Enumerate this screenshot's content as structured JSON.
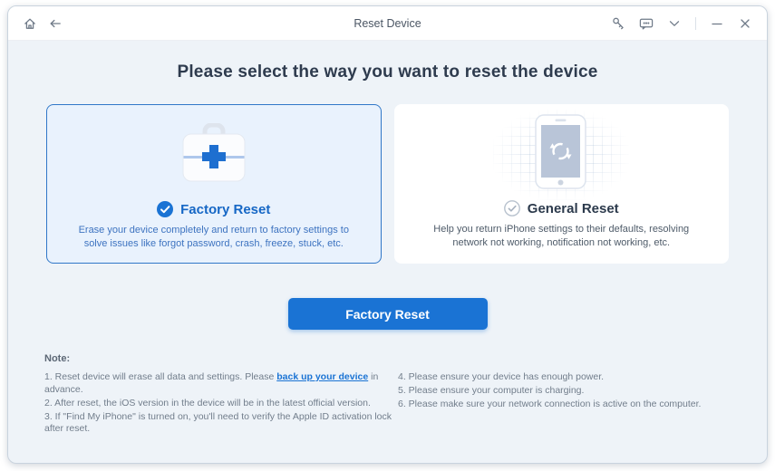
{
  "window": {
    "title": "Reset Device"
  },
  "titlebar_icons": [
    "home-icon",
    "back-icon",
    "register-key-icon",
    "feedback-icon",
    "menu-chevron-icon",
    "minimize-icon",
    "close-icon"
  ],
  "heading": "Please select the way you want to reset the device",
  "cards": {
    "factory": {
      "title": "Factory Reset",
      "selected": true,
      "icon": "first-aid-kit-icon",
      "description": "Erase your device completely and return to factory settings to solve issues like forgot password, crash, freeze, stuck, etc."
    },
    "general": {
      "title": "General Reset",
      "selected": false,
      "icon": "phone-refresh-icon",
      "description": "Help you return iPhone settings to their defaults, resolving network not working, notification not working, etc."
    }
  },
  "action_button": {
    "label": "Factory Reset"
  },
  "notes": {
    "label": "Note:",
    "item1_prefix": "1. Reset device will erase all data and settings. Please ",
    "item1_link": "back up your device",
    "item1_suffix": " in advance.",
    "item2": "2. After reset, the iOS version in the device will be in the latest official version.",
    "item3": "3. If \"Find My iPhone\" is turned on, you'll need to verify the Apple ID activation lock after reset.",
    "item4": "4. Please ensure your device has enough power.",
    "item5": "5. Please ensure your computer is charging.",
    "item6": "6. Please make sure your network connection is active on the computer."
  },
  "colors": {
    "accent_blue": "#1a73d4",
    "selected_card_border": "#3077c8",
    "selected_card_bg": "#e9f2fd",
    "content_bg": "#eef3f8"
  }
}
